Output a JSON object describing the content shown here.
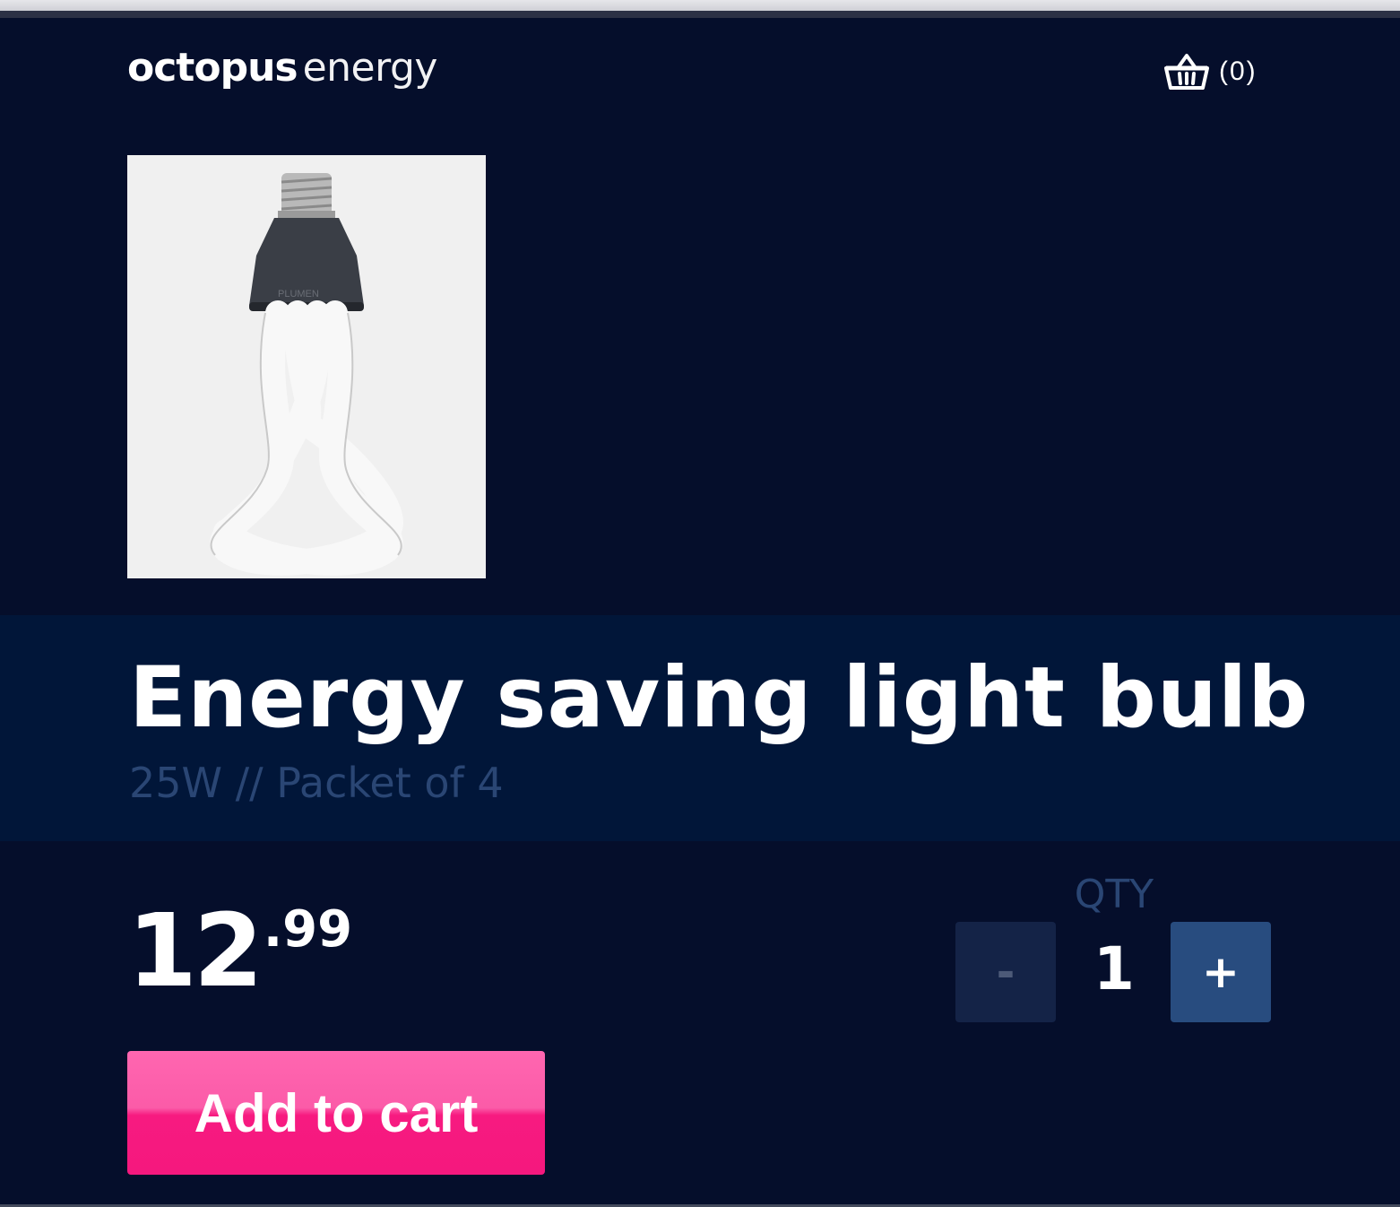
{
  "header": {
    "logo_bold": "octopus",
    "logo_light": "energy",
    "cart_count": "(0)"
  },
  "product": {
    "title": "Energy saving light bulb",
    "subtitle": "25W // Packet of 4",
    "image_brand": "PLUMEN",
    "price_whole": "12",
    "price_decimal": ".99"
  },
  "quantity": {
    "label": "QTY",
    "minus_label": "-",
    "plus_label": "+",
    "value": "1"
  },
  "actions": {
    "add_to_cart_label": "Add to cart"
  },
  "colors": {
    "background": "#050e2b",
    "title_band": "#011639",
    "accent_pink": "#f71a80",
    "muted_blue": "#2a4674",
    "plus_button": "#284c7f"
  }
}
